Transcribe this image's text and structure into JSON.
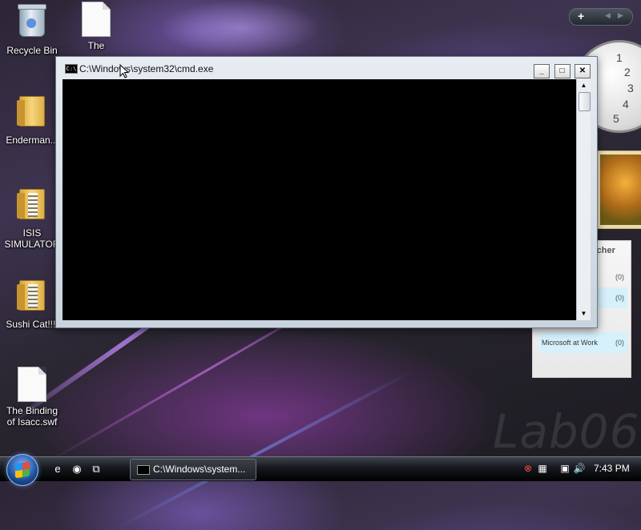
{
  "desktop": {
    "icons": [
      {
        "label": "Recycle Bin",
        "icon": "recycle-bin-icon"
      },
      {
        "label": "The",
        "icon": "document-icon"
      },
      {
        "label": "Enderman...",
        "icon": "folder-icon"
      },
      {
        "label": "ISIS SIMULATOR",
        "icon": "zip-folder-icon"
      },
      {
        "label": "Sushi Cat!!!!",
        "icon": "zip-folder-icon"
      },
      {
        "label": "The Binding of Isacc.swf",
        "icon": "document-icon"
      }
    ],
    "watermark": "Lab06"
  },
  "sidebar": {
    "clock_numbers": [
      "1",
      "2",
      "3",
      "4",
      "5"
    ],
    "feed": {
      "title": "tcher",
      "rows": [
        {
          "name": "",
          "count": "(0)",
          "highlight": false
        },
        {
          "name": "",
          "count": "(0)",
          "highlight": true
        },
        {
          "name": "",
          "count": "",
          "highlight": false
        },
        {
          "name": "Microsoft at Work",
          "count": "(0)",
          "highlight": true
        },
        {
          "name": "",
          "count": "",
          "highlight": false
        }
      ]
    }
  },
  "window": {
    "title": "C:\\Windows\\system32\\cmd.exe",
    "icon": "cmd-icon",
    "icon_text": "C:\\",
    "minimize": "_",
    "maximize": "□",
    "close": "✕"
  },
  "taskbar": {
    "task_label": "C:\\Windows\\system...",
    "time": "7:43 PM",
    "colors": {
      "console_bg": "#000000",
      "taskbar": "#15181d"
    }
  }
}
